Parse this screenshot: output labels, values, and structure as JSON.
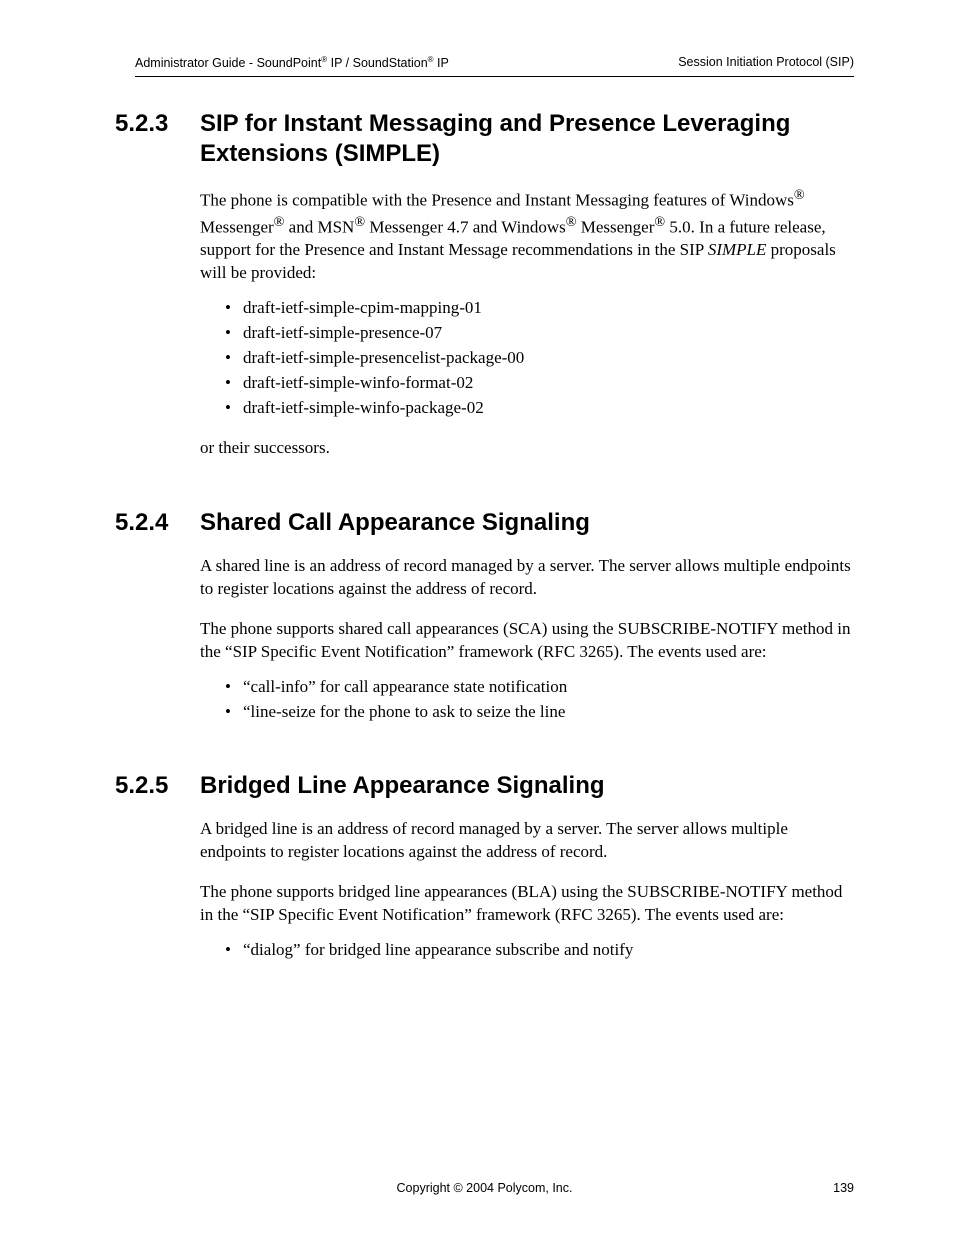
{
  "header": {
    "left_prefix": "Administrator Guide - SoundPoint",
    "left_mid": " IP / SoundStation",
    "left_suffix": " IP",
    "right": "Session Initiation Protocol (SIP)"
  },
  "sections": [
    {
      "num": "5.2.3",
      "title": "SIP for Instant Messaging and Presence Leveraging Extensions (SIMPLE)",
      "para1_a": "The phone is compatible with the Presence and Instant Messaging features of Windows",
      "para1_b": " Messenger",
      "para1_c": " and MSN",
      "para1_d": " Messenger 4.7 and Windows",
      "para1_e": " Messenger",
      "para1_f": " 5.0.  In a future release, support for the Presence and Instant Message recommendations in the SIP ",
      "para1_em": "SIMPLE",
      "para1_g": " proposals will be provided:",
      "bullets": [
        "draft-ietf-simple-cpim-mapping-01",
        "draft-ietf-simple-presence-07",
        "draft-ietf-simple-presencelist-package-00",
        "draft-ietf-simple-winfo-format-02",
        "draft-ietf-simple-winfo-package-02"
      ],
      "para2": "or their successors."
    },
    {
      "num": "5.2.4",
      "title": "Shared Call Appearance Signaling",
      "para1": "A shared line is an address of record managed by a server.  The server allows multiple endpoints to register locations against the address of record.",
      "para2": "The phone supports shared call appearances (SCA) using the SUBSCRIBE-NOTIFY method in the “SIP Specific Event Notification” framework (RFC 3265).  The events used are:",
      "bullets": [
        "“call-info” for call appearance state notification",
        "“line-seize for the phone to ask to seize the line"
      ]
    },
    {
      "num": "5.2.5",
      "title": "Bridged Line Appearance Signaling",
      "para1": "A bridged line is an address of record managed by a server.  The server allows multiple endpoints to register locations against the address of record.",
      "para2": "The phone supports bridged line appearances (BLA) using the SUBSCRIBE-NOTIFY method in the “SIP Specific Event Notification” framework (RFC 3265).  The events used are:",
      "bullets": [
        "“dialog” for bridged line appearance subscribe and notify"
      ]
    }
  ],
  "footer": {
    "center": "Copyright © 2004 Polycom, Inc.",
    "right": "139"
  }
}
